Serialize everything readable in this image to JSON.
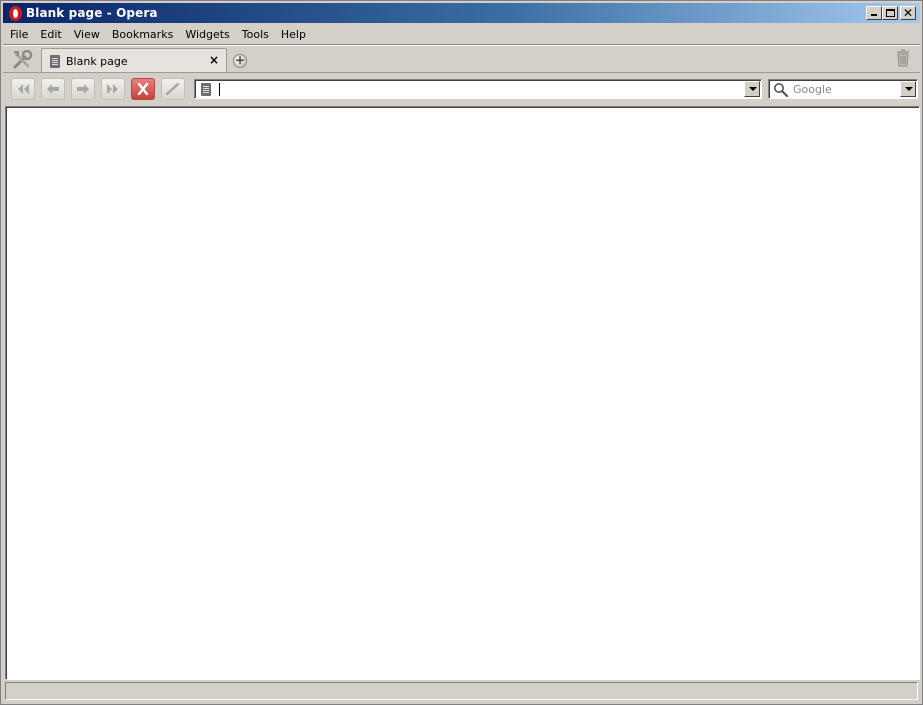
{
  "window": {
    "title": "Blank page - Opera"
  },
  "menu": {
    "items": [
      {
        "label": "File"
      },
      {
        "label": "Edit"
      },
      {
        "label": "View"
      },
      {
        "label": "Bookmarks"
      },
      {
        "label": "Widgets"
      },
      {
        "label": "Tools"
      },
      {
        "label": "Help"
      }
    ]
  },
  "tabs": [
    {
      "label": "Blank page",
      "close": "×"
    }
  ],
  "new_tab": {
    "label": "+"
  },
  "address": {
    "value": "",
    "placeholder": ""
  },
  "search": {
    "value": "",
    "placeholder": "Google"
  },
  "colors": {
    "stop": "#c8413c",
    "title_gradient_start": "#0a246a",
    "title_gradient_end": "#a6caf0"
  }
}
